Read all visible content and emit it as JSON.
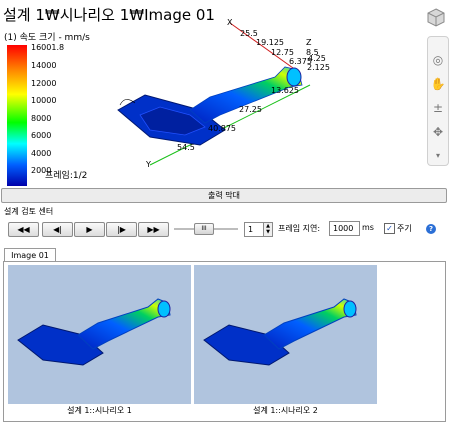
{
  "viewport": {
    "title": "설계 1₩시나리오 1₩Image 01",
    "subtitle": "(1) 속도 크기 - mm/s",
    "legend": [
      "16001.8",
      "14000",
      "12000",
      "10000",
      "8000",
      "6000",
      "4000",
      "2000"
    ],
    "frame_label": "프레임:1/2",
    "dimension_labels": [
      "25.5",
      "19.125",
      "12.75",
      "8.5",
      "6.375",
      "4.25",
      "2.125",
      "13.625",
      "27.25",
      "40.875",
      "54.5"
    ],
    "axis_labels": [
      "X",
      "Y",
      "Z"
    ]
  },
  "output_bar": {
    "label": "출력 막대"
  },
  "review": {
    "title": "설계 검토 센터",
    "buttons": {
      "first": "◀◀",
      "prev": "◀|",
      "play": "▶",
      "next": "|▶",
      "last": "▶▶"
    },
    "frame_value": "1",
    "delay_label": "프레임 지연:",
    "delay_value": "1000",
    "ms_label": "ms",
    "loop_label": "주기",
    "loop_checked": "✓"
  },
  "tabs": {
    "image": "Image 01"
  },
  "thumbnails": [
    {
      "caption": "설계 1::시나리오 1"
    },
    {
      "caption": "설계 1::시나리오 2"
    }
  ],
  "colors": {
    "thumb_bg": "#b0c4de",
    "accent": "#2b6fd6"
  }
}
